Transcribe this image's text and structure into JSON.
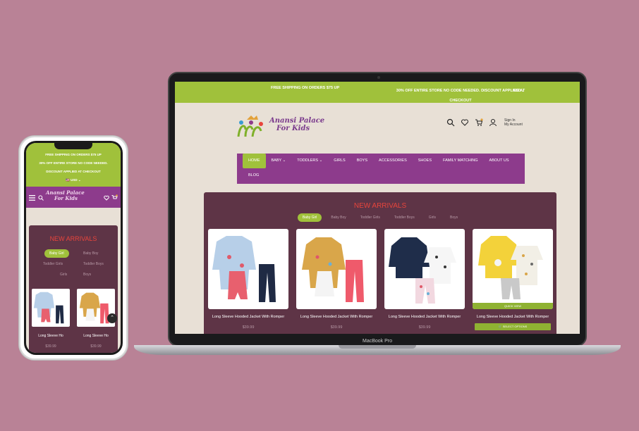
{
  "colors": {
    "accent": "#a0c13b",
    "brand_purple": "#8d3b8c",
    "section_bg": "#5e3446",
    "title_red": "#e8453c",
    "background": "#b98296"
  },
  "laptop": {
    "brand": "MacBook Pro",
    "topbar": {
      "shipping": "FREE SHIPPING ON ORDERS $75 UP",
      "discount": "30% OFF ENTIRE STORE NO CODE NEEDED. DISCOUNT APPLIED AT CHECKOUT",
      "currency": "USD"
    },
    "logo": {
      "line1": "Anansi Palace",
      "line2": "For Kids"
    },
    "header": {
      "signin": "Sign In",
      "account": "My Account"
    },
    "nav": [
      "HOME",
      "BABY",
      "TODDLERS",
      "GIRLS",
      "BOYS",
      "ACCESSORIES",
      "SHOES",
      "FAMILY MATCHING",
      "ABOUT US",
      "BLOG"
    ],
    "arrivals": {
      "title": "NEW ARRIVALS",
      "tabs": [
        "Baby Girl",
        "Baby Boy",
        "Toddler Girls",
        "Toddler Boys",
        "Girls",
        "Boys"
      ],
      "products": [
        {
          "name": "Long Sleeve Hooded Jacket With Romper",
          "price": "$39.99"
        },
        {
          "name": "Long Sleeve Hooded Jacket With Romper",
          "price": "$39.99"
        },
        {
          "name": "Long Sleeve Hooded Jacket With Romper",
          "price": "$39.99"
        },
        {
          "name": "Long Sleeve Hooded Jacket With Romper",
          "quick_view": "QUICK VIEW",
          "select": "SELECT OPTIONS"
        }
      ]
    }
  },
  "phone": {
    "topbar": {
      "line1": "FREE SHIPPING ON ORDERS $75 UP",
      "line2": "30% OFF ENTIRE STORE NO CODE NEEDED.",
      "line3": "DISCOUNT APPLIED AT CHECKOUT",
      "currency": "USD"
    },
    "logo": {
      "line1": "Anansi Palace",
      "line2": "For Kids"
    },
    "arrivals": {
      "title": "NEW ARRIVALS",
      "tabs": [
        "Baby Girl",
        "Baby Boy",
        "Toddler Girls",
        "Toddler Boys",
        "Girls",
        "Boys"
      ],
      "products": [
        {
          "name": "Long Sleeve Ho",
          "price": "$39.99"
        },
        {
          "name": "Long Sleeve Ho",
          "price": "$39.99"
        }
      ]
    }
  }
}
